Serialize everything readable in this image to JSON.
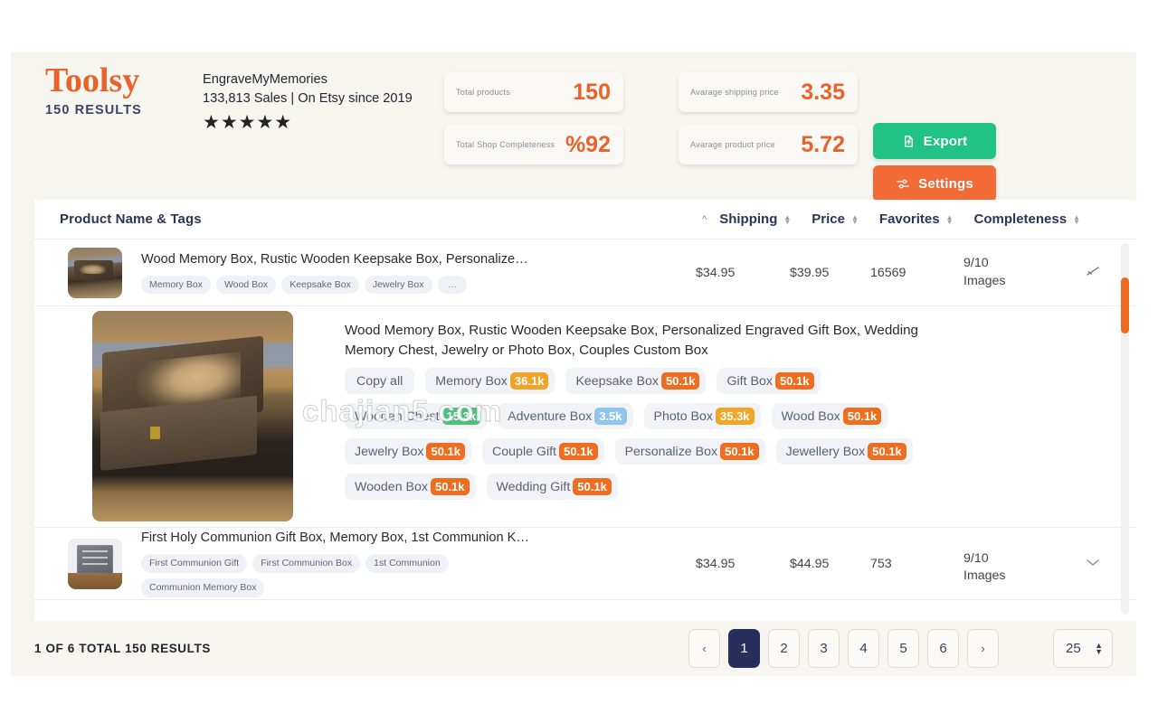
{
  "brand": {
    "name": "Toolsy",
    "results_label": "150 RESULTS"
  },
  "shop": {
    "name": "EngraveMyMemories",
    "meta": "133,813 Sales | On Etsy since 2019",
    "stars": "★★★★★"
  },
  "stats": [
    {
      "label": "Total products",
      "value": "150"
    },
    {
      "label": "Total Shop Completeness",
      "value": "%92"
    },
    {
      "label": "Avarage shipping price",
      "value": "3.35"
    },
    {
      "label": "Avarage product price",
      "value": "5.72"
    }
  ],
  "actions": {
    "export": "Export",
    "settings": "Settings"
  },
  "table": {
    "headers": {
      "name": "Product Name & Tags",
      "shipping": "Shipping",
      "price": "Price",
      "favorites": "Favorites",
      "completeness": "Completeness"
    },
    "rows": [
      {
        "title": "Wood Memory Box, Rustic Wooden Keepsake Box, Personalize…",
        "chips": [
          "Memory Box",
          "Wood Box",
          "Keepsake Box",
          "Jewelry Box",
          "…"
        ],
        "shipping": "$34.95",
        "price": "$39.95",
        "favorites": "16569",
        "completeness": "9/10 Images"
      },
      {
        "title": "Wood Memory Box, Rustic Wooden Keepsake Box, Personalized Engraved Gift Box, Wedding Memory Chest, Jewelry or Photo Box, Couples Custom Box",
        "copy_all": "Copy all",
        "tags": [
          {
            "label": "Memory Box",
            "count": "36.1k",
            "color": "#f0a528"
          },
          {
            "label": "Keepsake Box",
            "count": "50.1k",
            "color": "#ef6d1f"
          },
          {
            "label": "Gift Box",
            "count": "50.1k",
            "color": "#ef6d1f"
          },
          {
            "label": "Wooden Chest",
            "count": "15.3k",
            "color": "#4cc07e"
          },
          {
            "label": "Adventure Box",
            "count": "3.5k",
            "color": "#8ec6ed"
          },
          {
            "label": "Photo Box",
            "count": "35.3k",
            "color": "#f0a528"
          },
          {
            "label": "Wood Box",
            "count": "50.1k",
            "color": "#ef6d1f"
          },
          {
            "label": "Jewelry Box",
            "count": "50.1k",
            "color": "#ef6d1f"
          },
          {
            "label": "Couple Gift",
            "count": "50.1k",
            "color": "#ef6d1f"
          },
          {
            "label": "Personalize Box",
            "count": "50.1k",
            "color": "#ef6d1f"
          },
          {
            "label": "Jewellery Box",
            "count": "50.1k",
            "color": "#ef6d1f"
          },
          {
            "label": "Wooden Box",
            "count": "50.1k",
            "color": "#ef6d1f"
          },
          {
            "label": "Wedding Gift",
            "count": "50.1k",
            "color": "#ef6d1f"
          }
        ]
      },
      {
        "title": "First Holy Communion Gift Box, Memory Box, 1st Communion K…",
        "chips": [
          "First Communion Gift",
          "First Communion Box",
          "1st Communion",
          "Communion Memory Box"
        ],
        "shipping": "$34.95",
        "price": "$44.95",
        "favorites": "753",
        "completeness": "9/10 Images"
      }
    ]
  },
  "watermark": "chajian5.com",
  "footer": {
    "count": "1 OF 6 TOTAL 150 RESULTS",
    "prev": "‹",
    "next": "›",
    "pages": [
      "1",
      "2",
      "3",
      "4",
      "5",
      "6"
    ],
    "active_page": "1",
    "page_size": "25"
  }
}
